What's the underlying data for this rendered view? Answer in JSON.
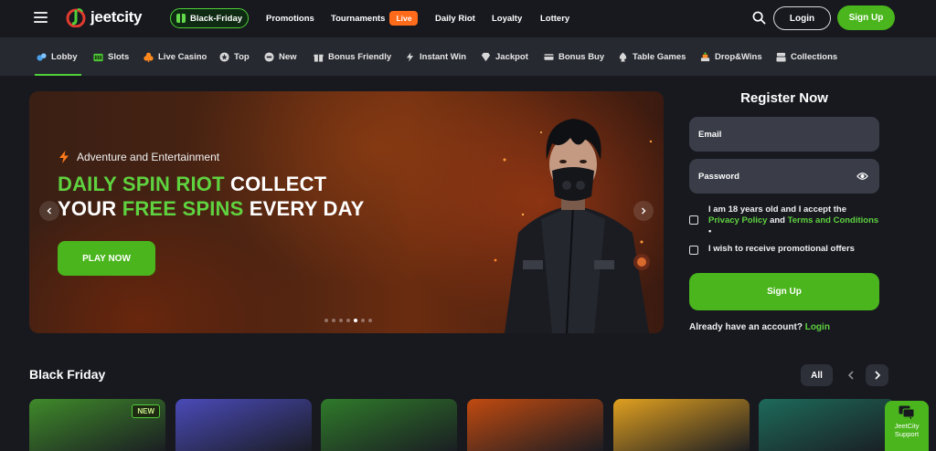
{
  "header": {
    "logo_text": "jeetcity",
    "black_friday_label": "Black-Friday",
    "nav": [
      {
        "label": "Promotions"
      },
      {
        "label": "Tournaments",
        "badge": "Live"
      },
      {
        "label": "Daily Riot"
      },
      {
        "label": "Loyalty"
      },
      {
        "label": "Lottery"
      }
    ],
    "login_label": "Login",
    "signup_label": "Sign Up",
    "accent_color": "#4ab51c"
  },
  "categories": [
    {
      "label": "Lobby",
      "icon": "lobby-icon",
      "active": true
    },
    {
      "label": "Slots",
      "icon": "slots-icon"
    },
    {
      "label": "Live Casino",
      "icon": "live-casino-icon"
    },
    {
      "label": "Top",
      "icon": "top-icon"
    },
    {
      "label": "New",
      "icon": "new-icon"
    },
    {
      "label": "Bonus Friendly",
      "icon": "bonus-friendly-icon"
    },
    {
      "label": "Instant Win",
      "icon": "instant-win-icon"
    },
    {
      "label": "Jackpot",
      "icon": "jackpot-icon"
    },
    {
      "label": "Bonus Buy",
      "icon": "bonus-buy-icon"
    },
    {
      "label": "Table Games",
      "icon": "table-games-icon"
    },
    {
      "label": "Drop&Wins",
      "icon": "drop-wins-icon"
    },
    {
      "label": "Collections",
      "icon": "collections-icon"
    }
  ],
  "hero": {
    "subtitle": "Adventure and Entertainment",
    "title_line1_green": "DAILY SPIN RIOT",
    "title_line1_white": " COLLECT",
    "title_line2_white": "YOUR ",
    "title_line2_green": "FREE SPINS",
    "title_line2_white_end": " EVERY DAY",
    "cta_label": "PLAY NOW",
    "slide_count": 7,
    "active_slide": 4
  },
  "register": {
    "title": "Register Now",
    "email_placeholder": "Email",
    "password_placeholder": "Password",
    "terms_text_1": "I am 18 years old and I accept the",
    "privacy_link": "Privacy Policy",
    "and_text": " and ",
    "terms_link": "Terms and Conditions",
    "required_mark": " •",
    "promo_text": "I wish to receive promotional offers",
    "signup_label": "Sign Up",
    "have_account_text": "Already have an account?",
    "login_link": "Login"
  },
  "black_friday": {
    "title": "Black Friday",
    "all_label": "All",
    "tiles": [
      {
        "badge": "NEW",
        "color": "#3f8a2a"
      },
      {
        "color": "#4a4ab8"
      },
      {
        "color": "#2f7a2a"
      },
      {
        "color": "#c04a10"
      },
      {
        "color": "#e0a020"
      },
      {
        "color": "#1d6a5a"
      }
    ]
  },
  "support": {
    "label_line1": "JeetCity",
    "label_line2": "Support"
  }
}
